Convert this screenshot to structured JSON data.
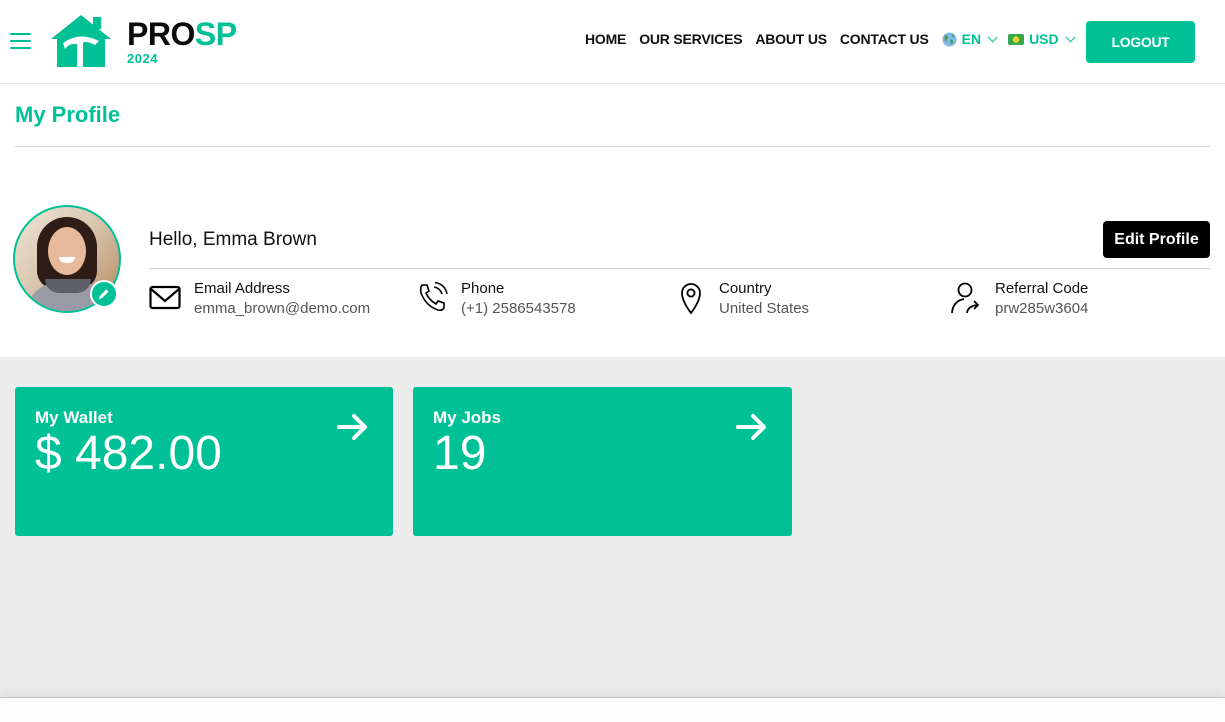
{
  "brand": {
    "name_part1": "PRO",
    "name_part2": "SP",
    "year": "2024",
    "accent_color": "#00c196"
  },
  "nav": {
    "items": [
      "HOME",
      "OUR SERVICES",
      "ABOUT US",
      "CONTACT US"
    ],
    "language": {
      "icon": "globe-icon",
      "selected": "EN"
    },
    "currency": {
      "icon": "money-icon",
      "selected": "USD"
    },
    "logout_label": "LOGOUT"
  },
  "page": {
    "title": "My Profile"
  },
  "profile": {
    "greeting": "Hello, Emma Brown",
    "edit_label": "Edit Profile",
    "fields": [
      {
        "icon": "envelope-icon",
        "label": "Email Address",
        "value": "emma_brown@demo.com"
      },
      {
        "icon": "phone-icon",
        "label": "Phone",
        "value": "(+1) 2586543578"
      },
      {
        "icon": "location-pin-icon",
        "label": "Country",
        "value": "United States"
      },
      {
        "icon": "user-share-icon",
        "label": "Referral Code",
        "value": "prw285w3604"
      }
    ]
  },
  "cards": [
    {
      "title": "My Wallet",
      "value": "$ 482.00",
      "icon": "arrow-right-icon"
    },
    {
      "title": "My Jobs",
      "value": "19",
      "icon": "arrow-right-icon"
    }
  ]
}
